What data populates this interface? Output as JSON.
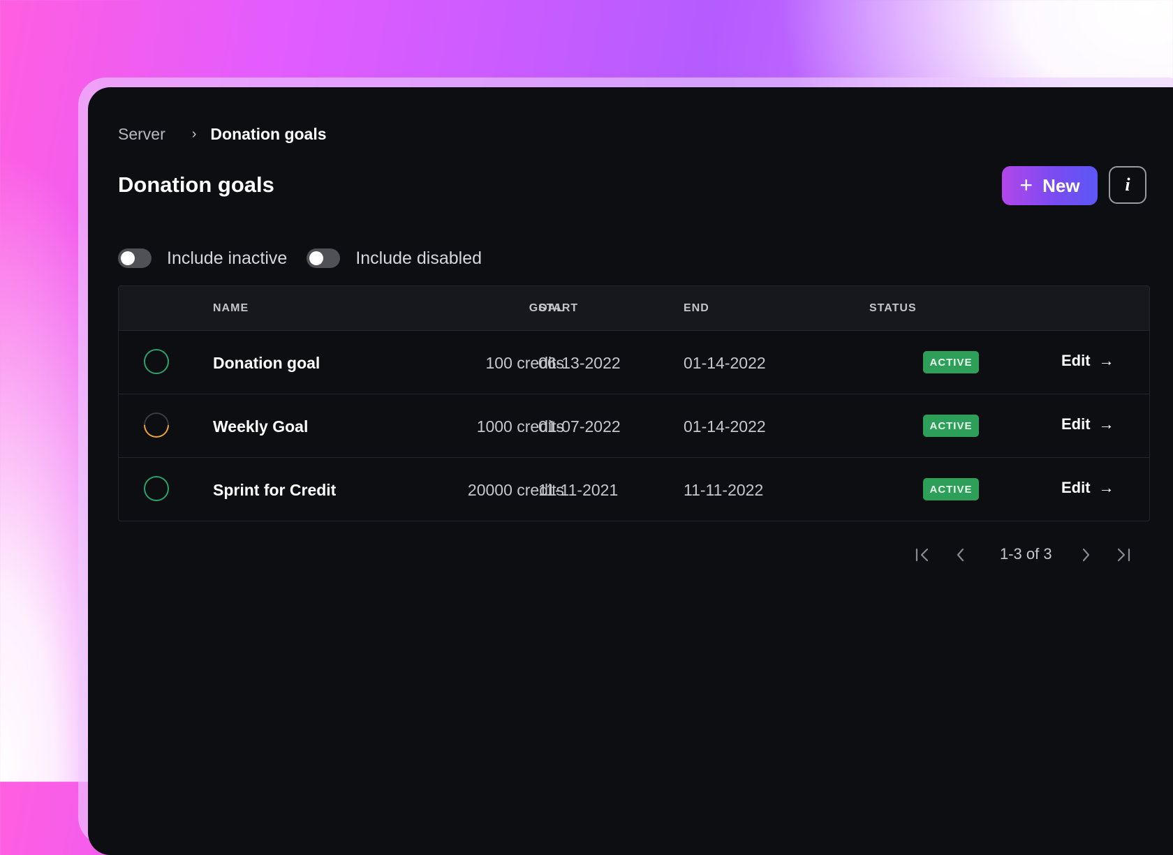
{
  "breadcrumb": {
    "root": "Server",
    "separator": "›",
    "current": "Donation goals"
  },
  "page": {
    "title": "Donation goals"
  },
  "actions": {
    "new_label": "New",
    "new_icon": "plus-icon",
    "info_label": "i"
  },
  "filters": [
    {
      "label": "Include inactive",
      "enabled": false
    },
    {
      "label": "Include disabled",
      "enabled": false
    }
  ],
  "table": {
    "headers": {
      "name": "NAME",
      "goal": "GOAL",
      "start": "START",
      "end": "END",
      "status": "STATUS"
    },
    "rows": [
      {
        "name": "Donation goal",
        "goal": "100 credits",
        "start": "06-13-2022",
        "end": "01-14-2022",
        "status": "ACTIVE",
        "action": "Edit",
        "progress_ring": "complete"
      },
      {
        "name": "Weekly Goal",
        "goal": "1000 credits",
        "start": "01-07-2022",
        "end": "01-14-2022",
        "status": "ACTIVE",
        "action": "Edit",
        "progress_ring": "partial"
      },
      {
        "name": "Sprint for Credit",
        "goal": "20000 credits",
        "start": "11-11-2021",
        "end": "11-11-2022",
        "status": "ACTIVE",
        "action": "Edit",
        "progress_ring": "complete"
      }
    ]
  },
  "pagination": {
    "summary": "1-3 of 3"
  },
  "colors": {
    "accent_start": "#b247ea",
    "accent_end": "#5c57f5",
    "status_active": "#2e9f58",
    "ring_complete": "#29a36a",
    "ring_partial": "#f0a434"
  }
}
